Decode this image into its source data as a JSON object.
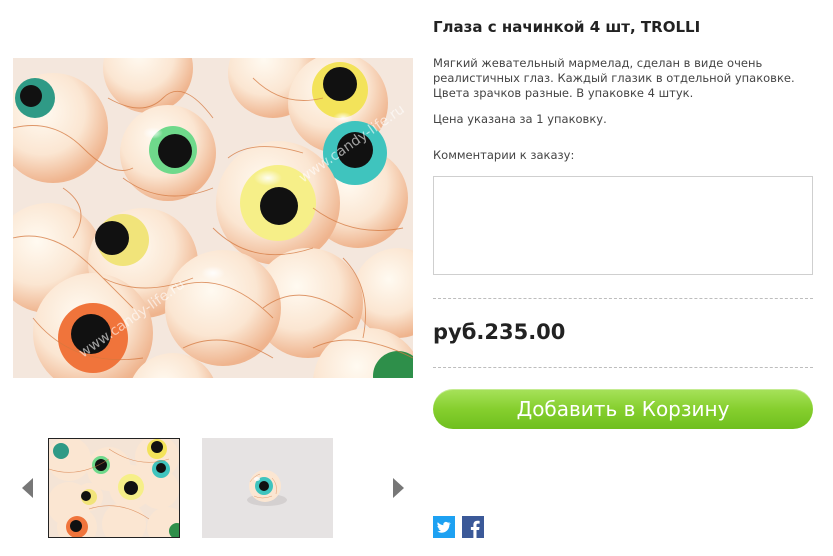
{
  "product": {
    "title": "Глаза с начинкой 4 шт, TROLLI",
    "description": "Мягкий жевательный мармелад, сделан в виде очень реалистичных глаз. Каждый глазик в отдельной упаковке. Цвета зрачков разные. В упаковке 4 штук.",
    "price_note": "Цена указана за 1 упаковку.",
    "comment_label": "Комментарии к заказу:",
    "comment_value": "",
    "price": "руб.235.00",
    "add_to_cart_label": "Добавить в Корзину"
  },
  "gallery": {
    "main_image": "gummy-eyeballs-photo",
    "thumbnails": [
      "gummy-eyeballs-pile",
      "single-gummy-eyeball"
    ],
    "prev_icon": "triangle-left-icon",
    "next_icon": "triangle-right-icon",
    "watermark": "www.candy-life.ru"
  },
  "social": {
    "twitter_icon": "twitter-icon",
    "facebook_icon": "facebook-icon",
    "twitter_color": "#1da1f2",
    "facebook_color": "#3b5998"
  },
  "colors": {
    "button_green": "#86cf2e",
    "text_dark": "#222222",
    "divider": "#bdbdbd"
  }
}
